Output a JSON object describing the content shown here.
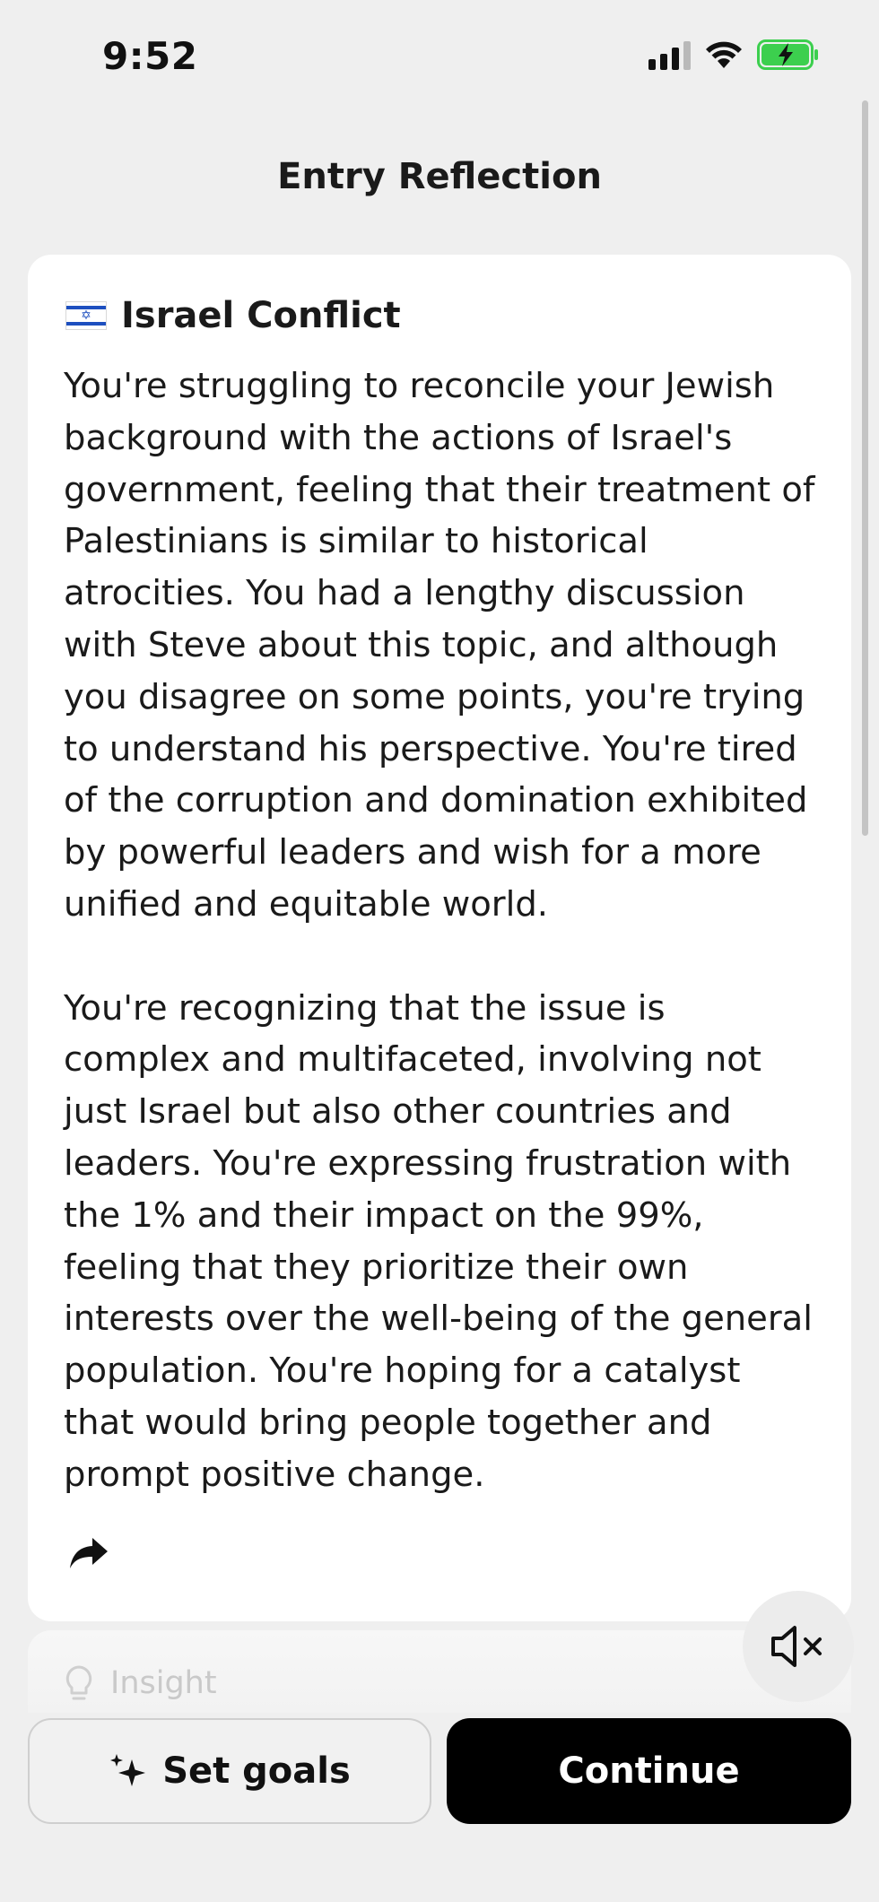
{
  "status_bar": {
    "time": "9:52"
  },
  "header": {
    "title": "Entry Reflection"
  },
  "card": {
    "title": "Israel Conflict",
    "paragraphs": [
      "You're struggling to reconcile your Jewish background with the actions of Israel's government, feeling that their treatment of Palestinians is similar to historical atrocities. You had a lengthy discussion with Steve about this topic, and although you disagree on some points, you're trying to understand his perspective. You're tired of the corruption and domination exhibited by powerful leaders and wish for a more unified and equitable world.",
      "You're recognizing that the issue is complex and multifaceted, involving not just Israel but also other countries and leaders. You're expressing frustration with the 1% and their impact on the 99%, feeling that they prioritize their own interests over the well-being of the general population. You're hoping for a catalyst that would bring people together and prompt positive change."
    ]
  },
  "insight": {
    "label": "Insight"
  },
  "buttons": {
    "set_goals": "Set goals",
    "continue": "Continue"
  },
  "colors": {
    "background": "#efefef",
    "card": "#ffffff",
    "primary_button": "#000000",
    "battery": "#3ccf4e",
    "flag_blue": "#1d4fbf"
  },
  "icons": {
    "flag": "israel-flag-icon",
    "share": "share-arrow-icon",
    "insight": "lightbulb-icon",
    "mute": "speaker-muted-icon",
    "sparkle": "sparkle-icon"
  }
}
